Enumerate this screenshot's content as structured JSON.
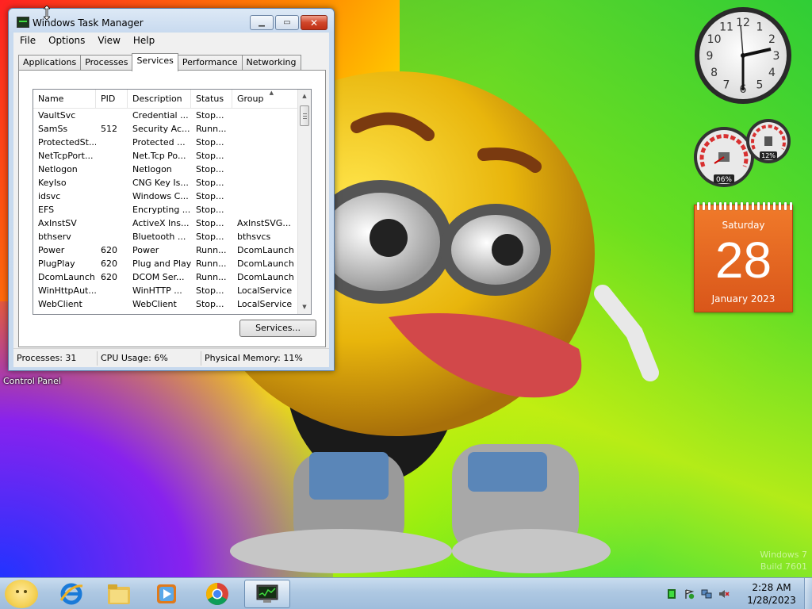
{
  "window": {
    "title": "Windows Task Manager",
    "menu": [
      "File",
      "Options",
      "View",
      "Help"
    ],
    "tabs": [
      "Applications",
      "Processes",
      "Services",
      "Performance",
      "Networking"
    ],
    "active_tab": "Services",
    "columns": [
      "Name",
      "PID",
      "Description",
      "Status",
      "Group"
    ],
    "rows": [
      [
        "VaultSvc",
        "",
        "Credential ...",
        "Stop...",
        ""
      ],
      [
        "SamSs",
        "512",
        "Security Ac...",
        "Runn...",
        ""
      ],
      [
        "ProtectedSt...",
        "",
        "Protected ...",
        "Stop...",
        ""
      ],
      [
        "NetTcpPort...",
        "",
        "Net.Tcp Po...",
        "Stop...",
        ""
      ],
      [
        "Netlogon",
        "",
        "Netlogon",
        "Stop...",
        ""
      ],
      [
        "KeyIso",
        "",
        "CNG Key Is...",
        "Stop...",
        ""
      ],
      [
        "idsvc",
        "",
        "Windows C...",
        "Stop...",
        ""
      ],
      [
        "EFS",
        "",
        "Encrypting ...",
        "Stop...",
        ""
      ],
      [
        "AxInstSV",
        "",
        "ActiveX Ins...",
        "Stop...",
        "AxInstSVG..."
      ],
      [
        "bthserv",
        "",
        "Bluetooth ...",
        "Stop...",
        "bthsvcs"
      ],
      [
        "Power",
        "620",
        "Power",
        "Runn...",
        "DcomLaunch"
      ],
      [
        "PlugPlay",
        "620",
        "Plug and Play",
        "Runn...",
        "DcomLaunch"
      ],
      [
        "DcomLaunch",
        "620",
        "DCOM Ser...",
        "Runn...",
        "DcomLaunch"
      ],
      [
        "WinHttpAut...",
        "",
        "WinHTTP ...",
        "Stop...",
        "LocalService"
      ],
      [
        "WebClient",
        "",
        "WebClient",
        "Stop...",
        "LocalService"
      ]
    ],
    "services_button": "Services...",
    "status": {
      "processes": "Processes: 31",
      "cpu": "CPU Usage: 6%",
      "memory": "Physical Memory: 11%"
    }
  },
  "desktop": {
    "control_panel_label": "Control Panel",
    "watermark_line1": "Windows 7",
    "watermark_line2": "Build 7601"
  },
  "gadgets": {
    "clock_numbers": [
      "12",
      "1",
      "2",
      "3",
      "4",
      "5",
      "6",
      "7",
      "8",
      "9",
      "10",
      "11"
    ],
    "cpu_meter": "06%",
    "memory_meter": "12%",
    "calendar": {
      "day": "Saturday",
      "date": "28",
      "month": "January 2023"
    }
  },
  "taskbar": {
    "apps": [
      "ie-icon",
      "folder-icon",
      "media-player-icon",
      "chrome-icon",
      "task-manager-icon"
    ],
    "time": "2:28 AM",
    "date": "1/28/2023"
  },
  "colors": {
    "calendar": "#e8691f",
    "close_button": "#c9401f",
    "taskbar": "#b5cde6"
  }
}
